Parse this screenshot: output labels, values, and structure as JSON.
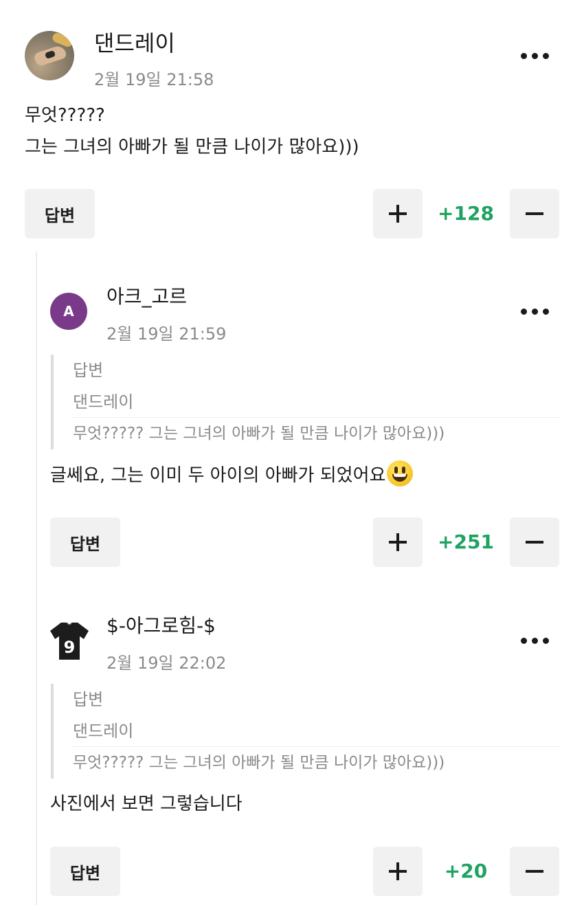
{
  "comments": [
    {
      "username": "댄드레이",
      "timestamp": "2월 19일 21:58",
      "avatar": "beach-photo-avatar",
      "lines": [
        "무엇?????",
        "그는 그녀의 아빠가 될 만큼 나이가 많아요)))"
      ],
      "reply_label": "답변",
      "votes": "+128"
    },
    {
      "username": "아크_고르",
      "timestamp": "2월 19일 21:59",
      "avatar_letter": "A",
      "avatar_color": "#7a3a8a",
      "quote": {
        "label": "답변",
        "author": "댄드레이",
        "text": "무엇????? 그는 그녀의 아빠가 될 만큼 나이가 많아요)))"
      },
      "text": "글쎄요, 그는 이미 두 아이의 아빠가 되었어요",
      "emoji": "grinning-face",
      "reply_label": "답변",
      "votes": "+251"
    },
    {
      "username": "$-아그로힘-$",
      "timestamp": "2월 19일 22:02",
      "avatar": "jersey-9-avatar",
      "avatar_jersey_number": "9",
      "quote": {
        "label": "답변",
        "author": "댄드레이",
        "text": "무엇????? 그는 그녀의 아빠가 될 만큼 나이가 많아요)))"
      },
      "text": "사진에서 보면 그렇습니다",
      "reply_label": "답변",
      "votes": "+20"
    }
  ],
  "colors": {
    "vote_positive": "#1fa362",
    "button_bg": "#f1f1f1",
    "muted_text": "#8a8a8a"
  }
}
